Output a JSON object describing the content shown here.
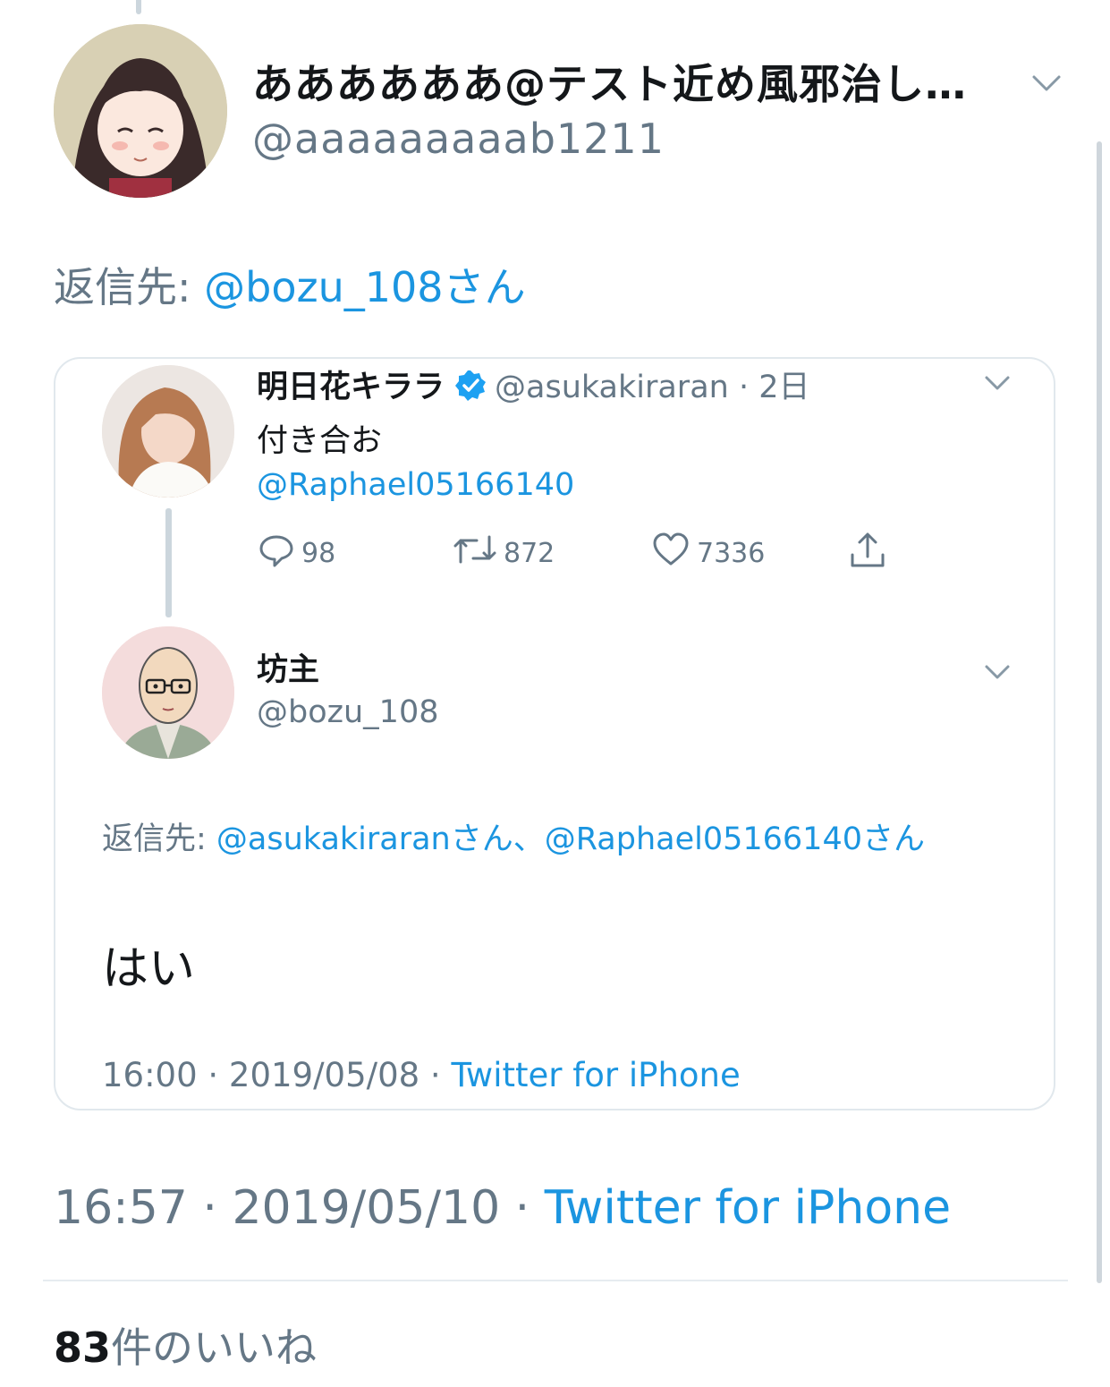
{
  "tweet": {
    "author": {
      "display_name": "ああああああ@テスト近め風邪治し…",
      "handle": "@aaaaaaaaab1211"
    },
    "reply_to": {
      "prefix": "返信先: ",
      "target": "@bozu_108さん"
    },
    "timestamp": "16:57 · 2019/05/10 · ",
    "client": "Twitter for iPhone",
    "likes": {
      "count": "83",
      "label": "件のいいね"
    }
  },
  "quoted": {
    "parent": {
      "display_name": "明日花キララ",
      "meta": "@asukakiraran · 2日",
      "text": "付き合お",
      "mention": "@Raphael05166140",
      "replies": "98",
      "retweets": "872",
      "likes": "7336"
    },
    "reply": {
      "display_name": "坊主",
      "handle": "@bozu_108",
      "reply_to_prefix": "返信先: ",
      "reply_to_targets": "@asukakiraranさん、@Raphael05166140さん",
      "text": "はい",
      "timestamp": "16:00 · 2019/05/08 · ",
      "client": "Twitter for iPhone"
    }
  },
  "colors": {
    "link": "#1b95e0",
    "secondary_text": "#657786",
    "border": "#e1e8ed"
  },
  "icons": [
    "chevron-down-icon",
    "verified-badge-icon",
    "reply-icon",
    "retweet-icon",
    "like-icon",
    "share-icon"
  ]
}
